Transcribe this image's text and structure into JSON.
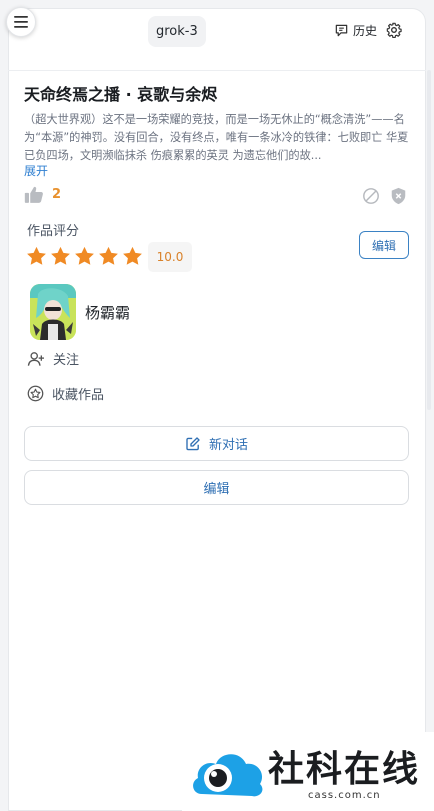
{
  "header": {
    "model": "grok-3",
    "history_label": "历史",
    "icons": {
      "menu": "hamburger-menu-icon",
      "history": "chat-history-icon",
      "settings": "gear-icon"
    }
  },
  "work": {
    "title": "天命终焉之播 · 哀歌与余烬",
    "description": "（超大世界观）这不是一场荣耀的竞技，而是一场无休止的“概念清洗”——名为“本源”的神罚。没有回合，没有终点，唯有一条冰冷的铁律：七败即亡 华夏已负四场，文明濒临抹杀 伤痕累累的英灵 为遗忘他们的故...",
    "expand_label": "展开",
    "likes": "2"
  },
  "rating": {
    "label": "作品评分",
    "score": "10.0",
    "stars": 5,
    "edit_label": "编辑"
  },
  "author": {
    "name": "杨霸霸",
    "follow_label": "关注",
    "collect_label": "收藏作品"
  },
  "actions": {
    "new_chat_label": "新对话",
    "edit_label": "编辑"
  },
  "watermark": {
    "text": "社科在线",
    "sub": "cass.com.cn"
  },
  "colors": {
    "accent": "#2f6fb3",
    "star": "#f08a24",
    "like": "#e8912e"
  }
}
